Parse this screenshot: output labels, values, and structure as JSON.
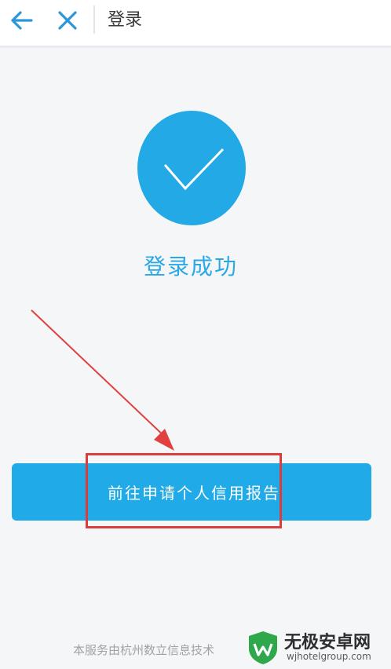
{
  "header": {
    "title": "登录"
  },
  "status": {
    "message": "登录成功"
  },
  "action": {
    "primary_label": "前往申请个人信用报告"
  },
  "footer": {
    "note": "本服务由杭州数立信息技术"
  },
  "watermark": {
    "name": "无极安卓网",
    "url": "wjhotelgroup.com"
  },
  "colors": {
    "accent": "#20aae8",
    "highlight": "#de3b3b",
    "watermark_green": "#2ea84a"
  },
  "icons": [
    "back-arrow-icon",
    "close-icon",
    "checkmark-icon"
  ]
}
